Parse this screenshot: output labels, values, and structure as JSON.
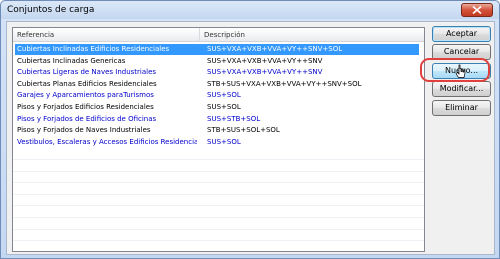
{
  "window": {
    "title": "Conjuntos de carga"
  },
  "columns": {
    "referencia": "Referencia",
    "descripcion": "Descripción"
  },
  "rows": [
    {
      "ref": "Cubiertas Inclinadas Edificios Residenciales",
      "desc": "SUS+VXA+VXB+VVA+VY++SNV+SOL",
      "style": "selected"
    },
    {
      "ref": "Cubiertas Inclinadas Genericas",
      "desc": "SUS+VXA+VXB+VVA+VY++SNV",
      "style": "black"
    },
    {
      "ref": "Cubiertas Ligeras de Naves Industriales",
      "desc": "SUS+VXA+VXB+VVA+VY++SNV",
      "style": "blue"
    },
    {
      "ref": "Cubiertas Planas Edificios Residenciales",
      "desc": "STB+SUS+VXA+VXB+VVA+VY++SNV+SOL",
      "style": "black"
    },
    {
      "ref": "Garajes y Aparcamientos paraTurismos",
      "desc": "SUS+SOL",
      "style": "blue"
    },
    {
      "ref": "Pisos y Forjados Edificios Residenciales",
      "desc": "SUS+SOL",
      "style": "black"
    },
    {
      "ref": "Pisos y Forjados de Edificios de Oficinas",
      "desc": "SUS+STB+SOL",
      "style": "blue"
    },
    {
      "ref": "Pisos y Forjados de Naves Industriales",
      "desc": "STB+SUS+SOL+SOL",
      "style": "black"
    },
    {
      "ref": "Vestibulos, Escaleras y Accesos Edificios Residenciales",
      "desc": "SUS+SOL",
      "style": "blue"
    }
  ],
  "buttons": {
    "aceptar": "Aceptar",
    "cancelar": "Cancelar",
    "nuevo": "Nuevo...",
    "modificar": "Modificar...",
    "eliminar": "Eliminar"
  },
  "colors": {
    "selection": "#3399ff",
    "blue_text": "#0000cc",
    "highlight_ring": "#e0413c"
  }
}
